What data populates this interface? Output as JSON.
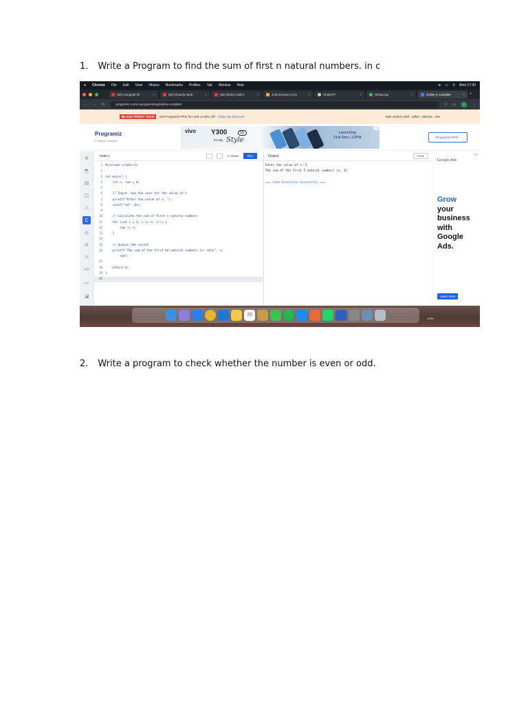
{
  "questions": [
    {
      "number": "1.",
      "text": "Write a Program to find the sum of first n natural numbers. in c"
    },
    {
      "number": "2.",
      "text": "Write a program to check whether the number is even or odd."
    }
  ],
  "screenshot": {
    "menubar": {
      "items": [
        "Chrome",
        "File",
        "Edit",
        "View",
        "History",
        "Bookmarks",
        "Profiles",
        "Tab",
        "Window",
        "Help"
      ],
      "clock": "Wed 17:30"
    },
    "tabs": [
      {
        "label": "(60) mongodb ful"
      },
      {
        "label": "(60) Dhanda Nyoli"
      },
      {
        "label": "(60) district matho"
      },
      {
        "label": "Joint Entrance Exa"
      },
      {
        "label": "ChatGPT"
      },
      {
        "label": "WhatsApp"
      },
      {
        "label": "Online C Compiler"
      }
    ],
    "address": "programiz.com/c-programming/online-compiler/",
    "promo": {
      "badge": "BLACK FRIDAY SALE",
      "text": "Get Programiz PRO for LIFE at 60% off!",
      "cta": "Claim My Discount",
      "timer": "Sale ends in 00d : 19hrs : 59mins : 46s"
    },
    "site": {
      "logo": "Programiz",
      "logo_sub": "C Online Compiler",
      "pro_button": "Programiz PRO ›"
    },
    "banner": {
      "brand": "vivo",
      "model": "Y300",
      "badge": "5G",
      "tagline": "It's My",
      "style_word": "Style",
      "launch_line1": "Launching",
      "launch_line2": "21st Nov | 12PM"
    },
    "editor": {
      "filename": "main.c",
      "share": "Share",
      "run": "Run",
      "lines": [
        {
          "n": "1",
          "code": "#include <stdio.h>"
        },
        {
          "n": "2",
          "code": ""
        },
        {
          "n": "3",
          "code": "int main() {"
        },
        {
          "n": "4",
          "code": "    int n, sum = 0;"
        },
        {
          "n": "5",
          "code": ""
        },
        {
          "n": "6",
          "code": "    // Input: Ask the user for the value of n"
        },
        {
          "n": "7",
          "code": "    printf(\"Enter the value of n: \");"
        },
        {
          "n": "8",
          "code": "    scanf(\"%d\", &n);"
        },
        {
          "n": "9",
          "code": ""
        },
        {
          "n": "10",
          "code": "    // Calculate the sum of first n natural numbers"
        },
        {
          "n": "11",
          "code": "    for (int i = 1; i <= n; i++) {"
        },
        {
          "n": "12",
          "code": "        sum += i;"
        },
        {
          "n": "13",
          "code": "    }"
        },
        {
          "n": "14",
          "code": ""
        },
        {
          "n": "15",
          "code": "    // Output the result"
        },
        {
          "n": "16",
          "code": "    printf(\"The sum of the first %d natural numbers is: %d\\n\", n,"
        },
        {
          "n": "",
          "code": "        sum);"
        },
        {
          "n": "17",
          "code": ""
        },
        {
          "n": "18",
          "code": "    return 0;"
        },
        {
          "n": "19",
          "code": "}"
        },
        {
          "n": "20",
          "code": ""
        }
      ]
    },
    "output": {
      "title": "Output",
      "clear": "Clear",
      "line1": "Enter the value of n: 5",
      "line2": "The sum of the first 5 natural numbers is: 15",
      "status": "=== Code Execution Successful ==="
    },
    "ad": {
      "label": "Google Ads",
      "line1": "Grow",
      "line2": "your",
      "line3": "business",
      "line4": "with",
      "line5": "Google",
      "line6": "Ads.",
      "cta": "Learn more"
    },
    "sidebar_icons": [
      "cpp-icon",
      "java-icon",
      "database-icon",
      "html-icon",
      "js-icon",
      "c-icon",
      "go-icon",
      "rust-icon",
      "kotlin-icon",
      "swift-icon",
      "php-icon",
      "misc-icon"
    ],
    "dock": {
      "date_badge": "20",
      "battery": "100%"
    },
    "colors": {
      "accent": "#1f62e0",
      "promo_bg": "#fdebd7",
      "sale_badge": "#e0433a"
    }
  }
}
